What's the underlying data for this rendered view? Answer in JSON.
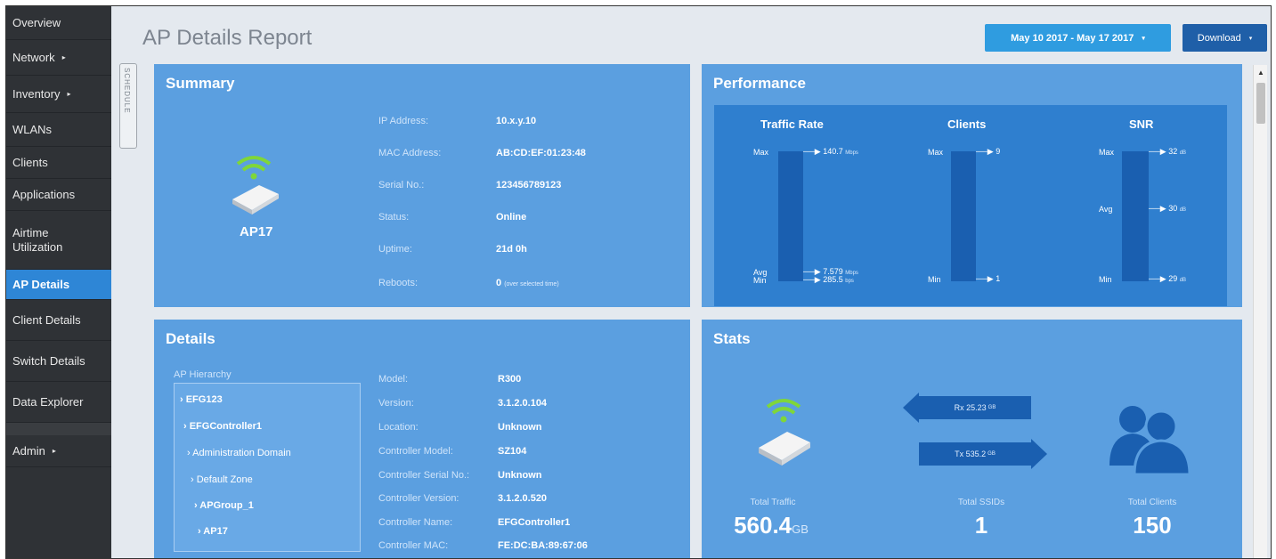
{
  "sidebar": {
    "items": [
      {
        "label": "Overview"
      },
      {
        "label": "Network",
        "arrow": "▸"
      },
      {
        "label": "Inventory",
        "arrow": "▸"
      },
      {
        "label": "WLANs"
      },
      {
        "label": "Clients"
      },
      {
        "label": "Applications"
      },
      {
        "label": "Airtime Utilization"
      },
      {
        "label": "AP Details"
      },
      {
        "label": "Client Details"
      },
      {
        "label": "Switch Details"
      },
      {
        "label": "Data Explorer"
      },
      {
        "label": "Admin",
        "arrow": "▸"
      }
    ]
  },
  "header": {
    "title": "AP Details Report",
    "date_range": "May 10 2017 - May 17 2017",
    "download": "Download",
    "caret": "▾"
  },
  "schedule_label": "SCHEDULE",
  "summary": {
    "title": "Summary",
    "ap_name": "AP17",
    "fields": [
      {
        "key": "IP Address:",
        "value": "10.x.y.10"
      },
      {
        "key": "MAC Address:",
        "value": "AB:CD:EF:01:23:48"
      },
      {
        "key": "Serial No.:",
        "value": "123456789123"
      },
      {
        "key": "Status:",
        "value": "Online"
      },
      {
        "key": "Uptime:",
        "value": "21d 0h"
      },
      {
        "key": "Reboots:",
        "value": "0",
        "note": "(over selected time)"
      }
    ]
  },
  "performance": {
    "title": "Performance",
    "traffic": {
      "title": "Traffic Rate",
      "max_label": "Max",
      "max_value": "140.7",
      "max_unit": "Mbps",
      "avg_label": "Avg",
      "avg_value": "7.579",
      "avg_unit": "Mbps",
      "min_label": "Min",
      "min_value": "285.5",
      "min_unit": "bps"
    },
    "clients": {
      "title": "Clients",
      "max_label": "Max",
      "max_value": "9",
      "min_label": "Min",
      "min_value": "1"
    },
    "snr": {
      "title": "SNR",
      "max_label": "Max",
      "max_value": "32",
      "max_unit": "dB",
      "avg_label": "Avg",
      "avg_value": "30",
      "avg_unit": "dB",
      "min_label": "Min",
      "min_value": "29",
      "min_unit": "dB"
    }
  },
  "details": {
    "title": "Details",
    "hierarchy_label": "AP Hierarchy",
    "hierarchy": [
      {
        "label": "› EFG123"
      },
      {
        "label": "› EFGController1"
      },
      {
        "label": "› Administration Domain"
      },
      {
        "label": "› Default Zone"
      },
      {
        "label": "› APGroup_1"
      },
      {
        "label": "› AP17"
      }
    ],
    "fields": [
      {
        "key": "Model:",
        "value": "R300"
      },
      {
        "key": "Version:",
        "value": "3.1.2.0.104"
      },
      {
        "key": "Location:",
        "value": "Unknown"
      },
      {
        "key": "Controller Model:",
        "value": "SZ104"
      },
      {
        "key": "Controller Serial No.:",
        "value": "Unknown"
      },
      {
        "key": "Controller Version:",
        "value": "3.1.2.0.520"
      },
      {
        "key": "Controller Name:",
        "value": "EFGController1"
      },
      {
        "key": "Controller MAC:",
        "value": "FE:DC:BA:89:67:06"
      }
    ]
  },
  "stats": {
    "title": "Stats",
    "rx": "Rx 25.23",
    "rx_unit": "GB",
    "tx": "Tx 535.2",
    "tx_unit": "GB",
    "total_traffic_label": "Total Traffic",
    "total_traffic_value": "560.4",
    "total_traffic_unit": "GB",
    "total_ssids_label": "Total SSIDs",
    "total_ssids_value": "1",
    "total_clients_label": "Total Clients",
    "total_clients_value": "150"
  },
  "colors": {
    "accent": "#2e86d6",
    "panel": "#5b9fe0",
    "wifi_green": "#7fd63a"
  }
}
